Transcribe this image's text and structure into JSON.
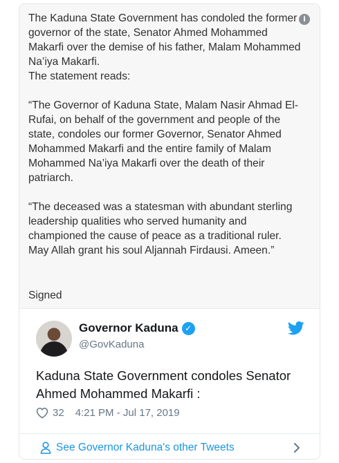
{
  "article": {
    "paragraphs": [
      "The Kaduna State Government has condoled the former governor of the state, Senator Ahmed Mohammed Makarfi over the demise of his father, Malam Mohammed Na’iya Makarfi.",
      "The statement reads:",
      "“The Governor of Kaduna State, Malam Nasir Ahmad El-Rufai, on behalf of the government and people of the state, condoles our former Governor, Senator Ahmed Mohammed Makarfi and the entire family of Malam Mohammed Na’iya Makarfi over the death of their patriarch.",
      "“The deceased was a statesman with abundant sterling leadership qualities who served humanity and championed the cause of peace as a traditional ruler. May Allah grant his soul Aljannah Firdausi. Ameen.”"
    ],
    "signed": "Signed",
    "info_icon": "i"
  },
  "tweet": {
    "name": "Governor Kaduna",
    "handle": "@GovKaduna",
    "text": "Kaduna State Government condoles Senator Ahmed Mohammed Makarfi :",
    "likes": "32",
    "timestamp": "4:21 PM - Jul 17, 2019",
    "see_more": "See Governor Kaduna's other Tweets",
    "verified_mark": "✓",
    "accent_color": "#1da1f2",
    "link_color": "#1b95e0"
  }
}
